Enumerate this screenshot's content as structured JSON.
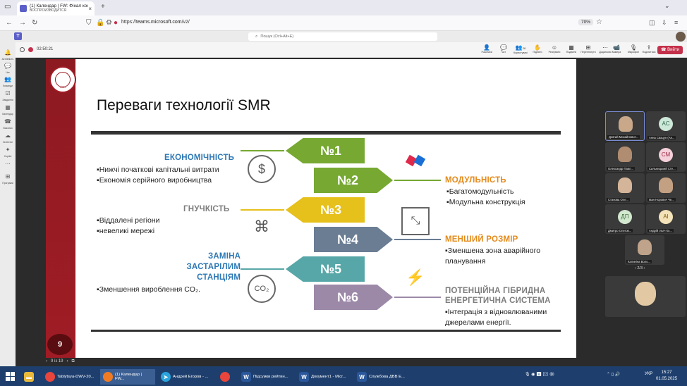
{
  "browser": {
    "tab_title": "(1) Календар | FW: Фінал конк...",
    "tab_subtitle": "ВОСПРОИЗВОДИТСЯ",
    "url_prefix": "https://",
    "url_host": "teams.microsoft.com",
    "url_path": "/v2/",
    "zoom": "70%"
  },
  "teams": {
    "search_placeholder": "Пошук (Ctrl+Alt+E)",
    "rail": [
      "Активність",
      "Чат",
      "Команди",
      "Завдання",
      "Календар",
      "Виклики",
      "OneDrive",
      "Copilot",
      "",
      "Програми"
    ],
    "timer": "02:50:21",
    "toolbar": [
      {
        "label": "Учасники"
      },
      {
        "label": "Чат"
      },
      {
        "label": "Користувачі"
      },
      {
        "label": "Підняти"
      },
      {
        "label": "Реагувати"
      },
      {
        "label": "Подання"
      },
      {
        "label": "Переглянути"
      },
      {
        "label": "Додатково"
      },
      {
        "label": "Камера"
      },
      {
        "label": "Мікрофон"
      },
      {
        "label": "Поділитися"
      }
    ],
    "leave": "Вийти",
    "participants_count": "28"
  },
  "slide": {
    "title": "Переваги технології SMR",
    "seal_year": "1885",
    "page": "9",
    "arrows": [
      "№1",
      "№2",
      "№3",
      "№4",
      "№5",
      "№6"
    ],
    "left": [
      {
        "heading": [
          "ЕКОНОМІЧНІСТЬ"
        ],
        "bullets": [
          "▪Нижчі початкові капітальні витрати",
          "▪Економія серійного виробництва"
        ]
      },
      {
        "heading": [
          "ГНУЧКІСТЬ"
        ],
        "bullets": [
          "▪Віддалені регіони",
          "▪невеликі мережі"
        ]
      },
      {
        "heading": [
          "ЗАМІНА",
          "ЗАСТАРІЛИМ",
          "СТАНЦІЯМ"
        ],
        "bullets": [
          "▪Зменшення вироблення CO₂."
        ]
      }
    ],
    "right": [
      {
        "heading": [
          "МОДУЛЬНІСТЬ"
        ],
        "bullets": [
          "▪Багатомодульність",
          "▪Модульна конструкція"
        ]
      },
      {
        "heading": [
          "МЕНШИЙ РОЗМІР"
        ],
        "bullets": [
          "▪Зменшена зона аварійного",
          "планування"
        ]
      },
      {
        "heading": [
          "ПОТЕНЦІЙНА ГІБРИДНА",
          "ЕНЕРГЕТИЧНА СИСТЕМА"
        ],
        "bullets": [
          "▪Інтеграція з відновлюваними",
          "джерелами енергії."
        ]
      }
    ],
    "nav": "9 із 19"
  },
  "participants": [
    {
      "name": "Довгий Михайлович...",
      "initials": ""
    },
    {
      "name": "Анна Свацун (Ан...",
      "initials": "АС"
    },
    {
      "name": "Олександр Павл...",
      "initials": ""
    },
    {
      "name": "Сильницький Сте...",
      "initials": "СМ"
    },
    {
      "name": "Станова Оле...",
      "initials": ""
    },
    {
      "name": "Іван Норович Че...",
      "initials": ""
    },
    {
      "name": "Дмитро Олегов...",
      "initials": "ДП"
    },
    {
      "name": "Андрій Ільїч Ко...",
      "initials": "АІ"
    },
    {
      "name": "Калиніна Воло...",
      "initials": ""
    }
  ],
  "pager": "2/3",
  "taskbar": {
    "items": [
      {
        "label": "Tablytsya-DWV-20...",
        "icon": "chrome",
        "color": "#e8453c"
      },
      {
        "label": "(1) Календар | FW...",
        "icon": "firefox",
        "color": "#f17b22"
      },
      {
        "label": "Андрей Егоров - ...",
        "icon": "telegram",
        "color": "#2aa3dd"
      },
      {
        "label": "",
        "icon": "chrome",
        "color": "#e8453c"
      },
      {
        "label": "Підсумки рейтин...",
        "icon": "word",
        "color": "#2b579a"
      },
      {
        "label": "Документ1 - Micr...",
        "icon": "word",
        "color": "#2b579a"
      },
      {
        "label": "Службова ДВВ Е...",
        "icon": "word",
        "color": "#2b579a"
      }
    ],
    "lang": "УКР",
    "time": "15:27",
    "date": "01.05.2025"
  },
  "colors": {
    "green": "#76a832",
    "gray_blue": "#6a7d93",
    "yellow": "#e6c01b",
    "teal": "#58a7a8",
    "mauve": "#9c89a8",
    "blue_heading": "#2d78b5",
    "orange_heading": "#e58a1a",
    "gray_heading": "#7d7d7d"
  }
}
